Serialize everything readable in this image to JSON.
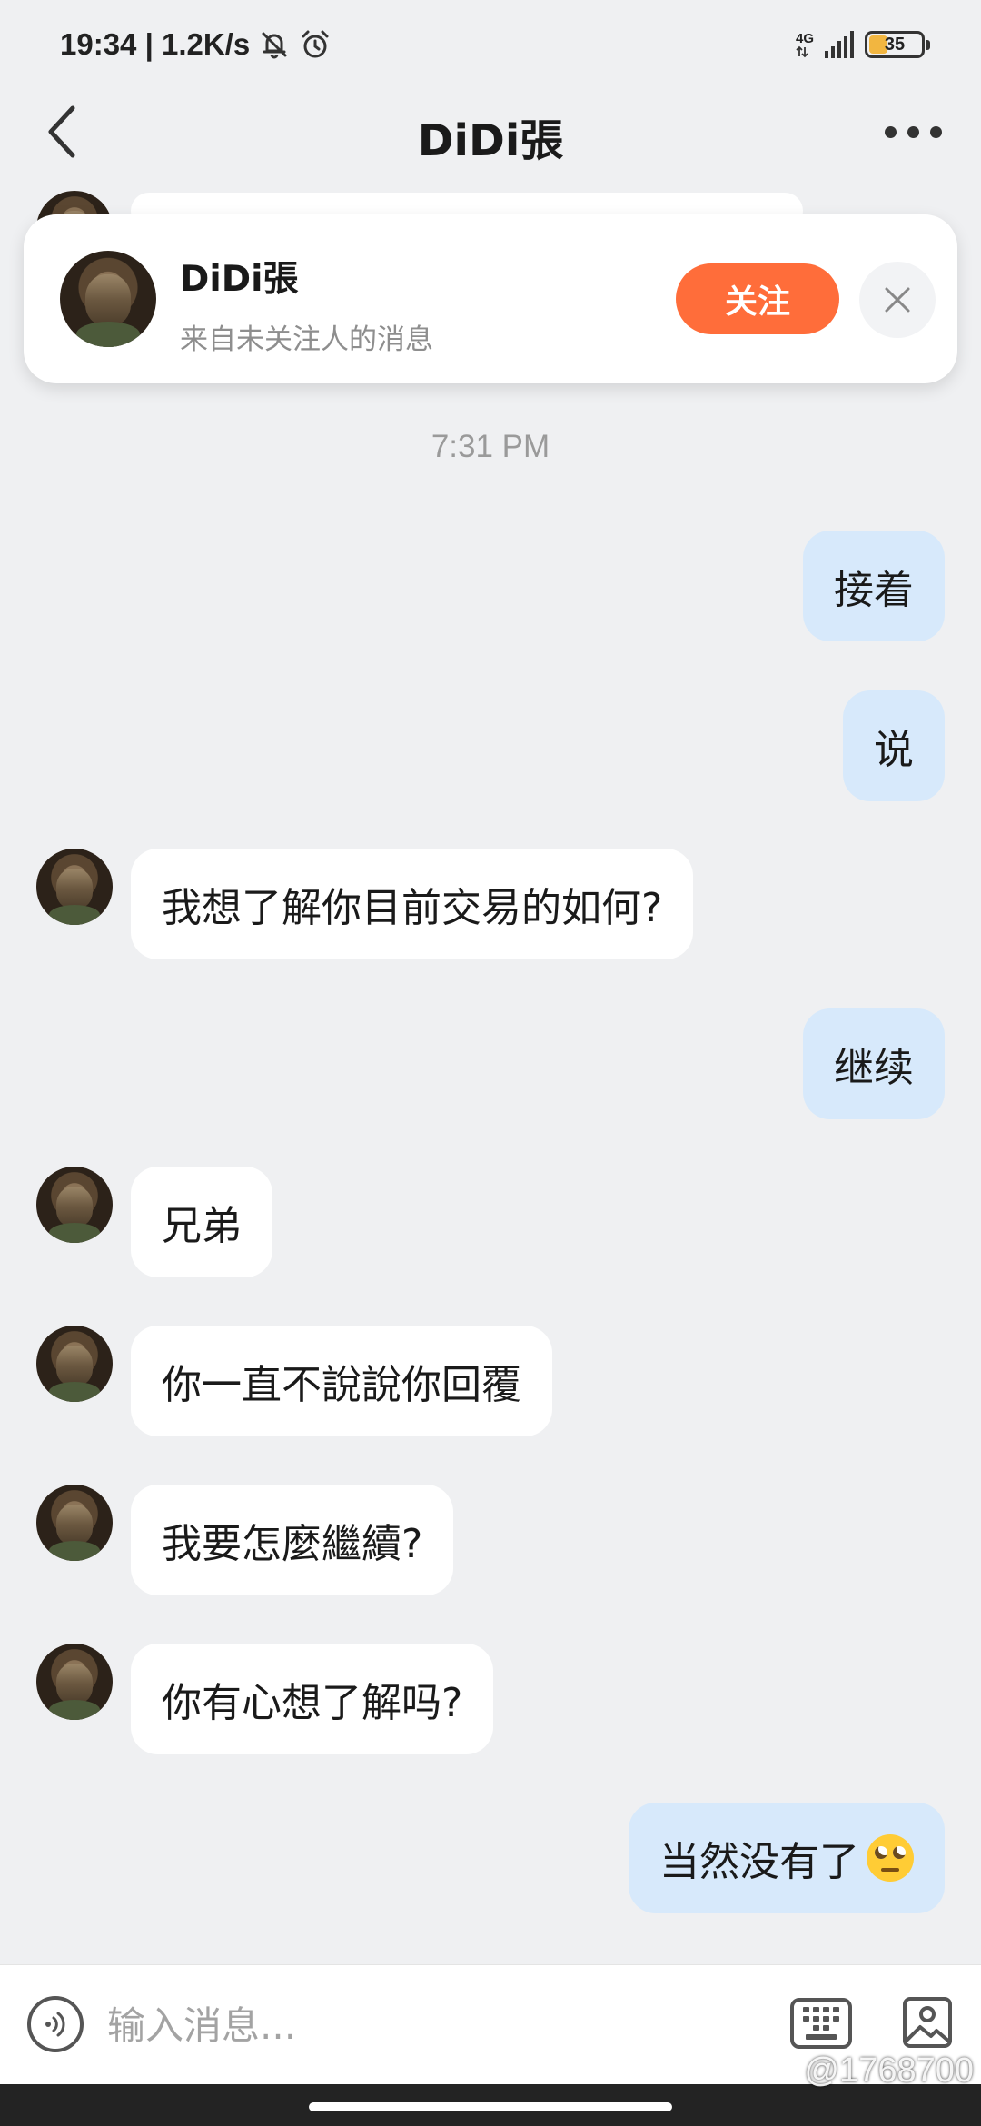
{
  "status_bar": {
    "time_speed": "19:34 | 1.2K/s",
    "network": "4G",
    "battery": "35",
    "battery_color": "#f2b640"
  },
  "header": {
    "title": "DiDi張",
    "back_icon": "chevron-left-icon",
    "more_icon": "more-dots-icon"
  },
  "follow_prompt": {
    "name": "DiDi張",
    "subtitle": "来自未关注人的消息",
    "follow_label": "关注",
    "follow_color": "#ff6d3a",
    "dismiss_icon": "close-icon"
  },
  "timestamp": "7:31 PM",
  "messages": [
    {
      "from": "me",
      "text": "接着"
    },
    {
      "from": "me",
      "text": "说"
    },
    {
      "from": "them",
      "text": "我想了解你目前交易的如何?"
    },
    {
      "from": "me",
      "text": "继续"
    },
    {
      "from": "them",
      "text": "兄弟"
    },
    {
      "from": "them",
      "text": "你一直不說說你回覆"
    },
    {
      "from": "them",
      "text": "我要怎麼繼續?"
    },
    {
      "from": "them",
      "text": "你有心想了解吗?"
    },
    {
      "from": "me",
      "text": "当然没有了",
      "emoji": "rolling-eyes-emoji"
    }
  ],
  "composer": {
    "placeholder": "输入消息...",
    "voice_icon": "voice-icon",
    "keyboard_icon": "keyboard-icon",
    "image_icon": "image-icon"
  },
  "watermark": "@1768700",
  "colors": {
    "outgoing_bubble": "#d7e9fb",
    "incoming_bubble": "#ffffff",
    "background": "#eff0f2"
  }
}
